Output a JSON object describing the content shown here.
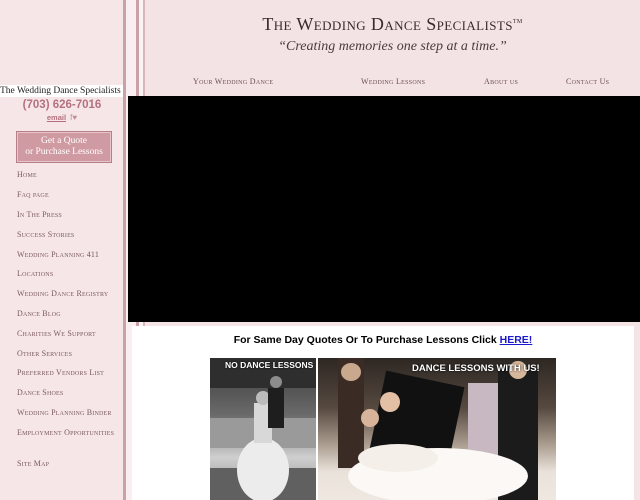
{
  "header": {
    "title": "The Wedding Dance Specialists",
    "trademark": "TM",
    "tagline": "“Creating memories one step at a time.”",
    "nav": [
      {
        "label": "Your Wedding Dance"
      },
      {
        "label": "Wedding Lessons"
      },
      {
        "label": "About us"
      },
      {
        "label": "Contact Us"
      }
    ]
  },
  "sidebar": {
    "site_name": "The Wedding Dance Specialists",
    "phone": "(703) 626-7016",
    "email_label": "email",
    "social_icons": [
      "facebook-icon",
      "twitter-icon"
    ],
    "quote_button": {
      "line1": "Get a Quote",
      "line2": "or Purchase Lessons"
    },
    "items": [
      {
        "label": "Home"
      },
      {
        "label": "Faq page"
      },
      {
        "label": "In The Press"
      },
      {
        "label": "Success Stories"
      },
      {
        "label": "Wedding Planning 411"
      },
      {
        "label": "Locations"
      },
      {
        "label": "Wedding Dance Registry"
      },
      {
        "label": "Dance Blog"
      },
      {
        "label": "Charities We Support"
      },
      {
        "label": "Other Services"
      },
      {
        "label": "Preferred Vendors List"
      },
      {
        "label": "Dance Shoes"
      },
      {
        "label": "Wedding Planning Binder"
      },
      {
        "label": "Employment Opportunities"
      },
      {
        "label": "Site Map"
      }
    ]
  },
  "content": {
    "cta_text": "For Same Day Quotes Or To Purchase Lessons Click ",
    "cta_link": "HERE!",
    "photo_left_label": "NO DANCE LESSONS",
    "photo_right_label": "DANCE LESSONS WITH US!"
  },
  "colors": {
    "accent": "#b4707e",
    "sidebar_bg": "#f6e6e8",
    "header_bg": "#f4e3e5",
    "button_bg": "#cf9aa2"
  }
}
